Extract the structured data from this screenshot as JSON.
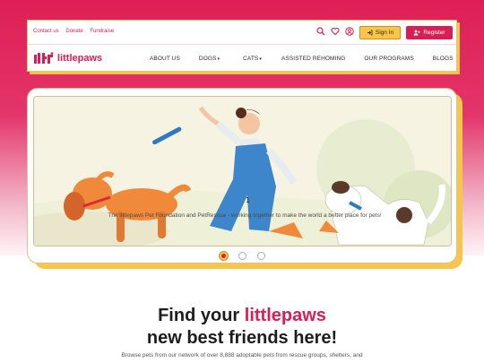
{
  "topbar": {
    "links": [
      "Contact us",
      "Donate",
      "Fundraise"
    ],
    "signin_label": "Sign In",
    "register_label": "Register",
    "icons": [
      "search-icon",
      "heart-icon",
      "user-circle-icon"
    ]
  },
  "brand": {
    "name": "littlepaws",
    "color": "#d81f55"
  },
  "nav": {
    "items": [
      "ABOUT US",
      "DOGS",
      "CATS",
      "ASSISTED REHOMING",
      "OUR PROGRAMS",
      "BLOGS"
    ]
  },
  "carousel": {
    "caption": "The littlepaws Pet Foundation and PetRescue - working together to make the world a better place for pets!",
    "slide_count": 3,
    "active_index": 0
  },
  "hero": {
    "line1_prefix": "Find your ",
    "line1_accent": "littlepaws",
    "line2": "new best friends here!",
    "subtitle": "Browse pets from our network of over 8,888 adoptable pets from rescue groups, shelters, and"
  },
  "colors": {
    "accent": "#d81f55",
    "yellow": "#f6c64b"
  }
}
